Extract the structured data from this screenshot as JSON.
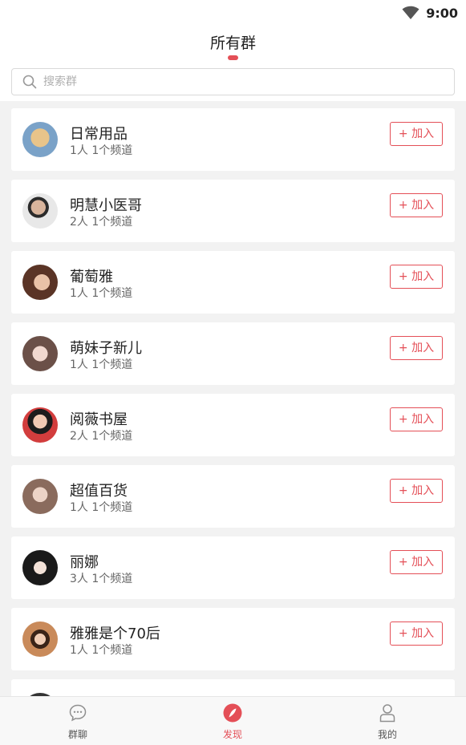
{
  "status": {
    "time": "9:00",
    "wifi_icon": "wifi-icon"
  },
  "header": {
    "title": "所有群",
    "accent": "#e44f57"
  },
  "search": {
    "placeholder": "搜索群",
    "value": ""
  },
  "groups": [
    {
      "name": "日常用品",
      "meta": "1人 1个频道",
      "join_label": "+ 加入",
      "avatar_color": "#c6a36a"
    },
    {
      "name": "明慧小医哥",
      "meta": "2人 1个频道",
      "join_label": "+ 加入",
      "avatar_color": "#b7b7b7"
    },
    {
      "name": "葡萄雅",
      "meta": "1人 1个频道",
      "join_label": "+ 加入",
      "avatar_color": "#8a5a45"
    },
    {
      "name": "萌妹子新儿",
      "meta": "1人 1个频道",
      "join_label": "+ 加入",
      "avatar_color": "#c9a79c"
    },
    {
      "name": "阅薇书屋",
      "meta": "2人 1个频道",
      "join_label": "+ 加入",
      "avatar_color": "#d23d3d"
    },
    {
      "name": "超值百货",
      "meta": "1人 1个频道",
      "join_label": "+ 加入",
      "avatar_color": "#b38a78"
    },
    {
      "name": "丽娜",
      "meta": "3人 1个频道",
      "join_label": "+ 加入",
      "avatar_color": "#3a3a3a"
    },
    {
      "name": "雅雅是个70后",
      "meta": "1人 1个频道",
      "join_label": "+ 加入",
      "avatar_color": "#a05a3a"
    },
    {
      "name": "",
      "meta": "",
      "join_label": "",
      "avatar_color": "#333333"
    }
  ],
  "tabs": [
    {
      "label": "群聊",
      "icon": "chat-bubble-icon",
      "active": false
    },
    {
      "label": "发现",
      "icon": "compass-icon",
      "active": true
    },
    {
      "label": "我的",
      "icon": "user-icon",
      "active": false
    }
  ],
  "colors": {
    "active": "#e44f57",
    "inactive": "#555555"
  }
}
